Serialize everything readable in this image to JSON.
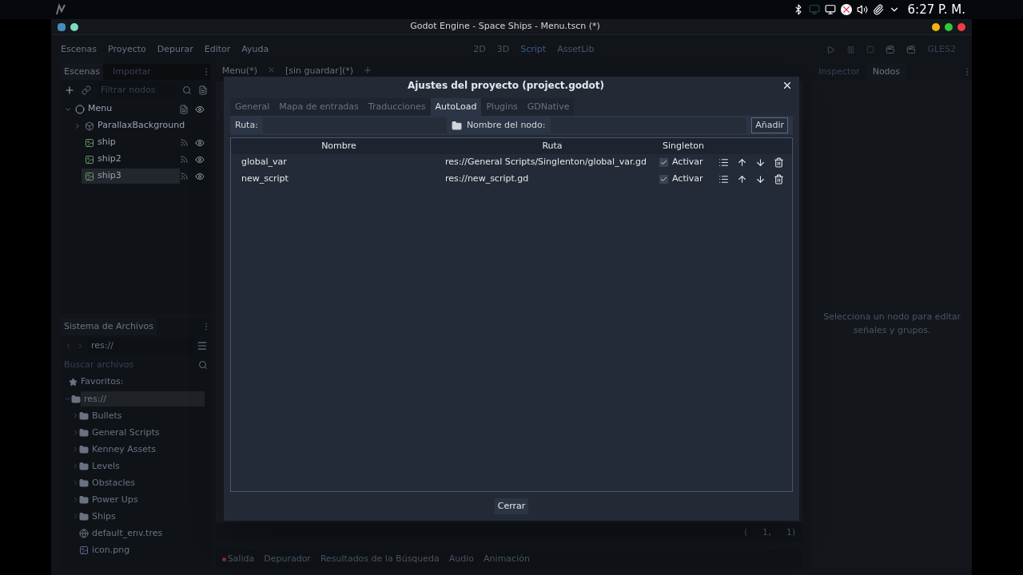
{
  "system_bar": {
    "time": "6:27 P. M."
  },
  "window": {
    "title": "Godot Engine - Space Ships - Menu.tscn (*)"
  },
  "menu": [
    "Escenas",
    "Proyecto",
    "Depurar",
    "Editor",
    "Ayuda"
  ],
  "workspaces": [
    {
      "label": "2D",
      "selected": false
    },
    {
      "label": "3D",
      "selected": false
    },
    {
      "label": "Script",
      "selected": true
    },
    {
      "label": "AssetLib",
      "selected": false
    }
  ],
  "renderer": "GLES2",
  "scene_dock": {
    "tabs": [
      {
        "label": "Escenas",
        "selected": true
      },
      {
        "label": "Importar",
        "selected": false
      }
    ],
    "filter_placeholder": "Filtrar nodos",
    "tree": [
      {
        "name": "Menu",
        "kind": "root",
        "selected": false,
        "children": [
          {
            "name": "ParallaxBackground",
            "kind": "parallax",
            "selected": false
          },
          {
            "name": "ship",
            "kind": "sprite",
            "selected": false
          },
          {
            "name": "ship2",
            "kind": "sprite",
            "selected": false
          },
          {
            "name": "ship3",
            "kind": "sprite",
            "selected": true
          }
        ]
      }
    ]
  },
  "filesystem": {
    "title": "Sistema de Archivos",
    "path": "res://",
    "search_placeholder": "Buscar archivos",
    "favorites": "Favoritos:",
    "tree": [
      {
        "name": "res://",
        "kind": "folder",
        "selected": true,
        "children": [
          {
            "name": "Bullets",
            "kind": "folder",
            "selected": false
          },
          {
            "name": "General Scripts",
            "kind": "folder",
            "selected": false
          },
          {
            "name": "Kenney Assets",
            "kind": "folder",
            "selected": false
          },
          {
            "name": "Levels",
            "kind": "folder",
            "selected": false
          },
          {
            "name": "Obstacles",
            "kind": "folder",
            "selected": false
          },
          {
            "name": "Power Ups",
            "kind": "folder",
            "selected": false
          },
          {
            "name": "Ships",
            "kind": "folder",
            "selected": false
          },
          {
            "name": "default_env.tres",
            "kind": "resource",
            "selected": false
          },
          {
            "name": "icon.png",
            "kind": "image",
            "selected": false
          }
        ]
      }
    ]
  },
  "editor_tabs": [
    "Menu(*)",
    "[sin guardar](*)"
  ],
  "cursor": "(   1,   1)",
  "bottom_tabs": [
    "Salida",
    "Depurador",
    "Resultados de la Búsqueda",
    "Audio",
    "Animación"
  ],
  "right_dock": {
    "tabs": [
      {
        "label": "Inspector",
        "selected": false
      },
      {
        "label": "Nodos",
        "selected": true
      }
    ],
    "message": "Selecciona un nodo para editar señales y grupos."
  },
  "dialog": {
    "title": "Ajustes del proyecto (project.godot)",
    "tabs": [
      {
        "label": "General",
        "selected": false
      },
      {
        "label": "Mapa de entradas",
        "selected": false
      },
      {
        "label": "Traducciones",
        "selected": false
      },
      {
        "label": "AutoLoad",
        "selected": true
      },
      {
        "label": "Plugins",
        "selected": false
      },
      {
        "label": "GDNative",
        "selected": false
      }
    ],
    "path_label": "Ruta:",
    "node_name_label": "Nombre del nodo:",
    "add_button": "Añadir",
    "columns": [
      "Nombre",
      "Ruta",
      "Singleton"
    ],
    "rows": [
      {
        "name": "global_var",
        "path": "res://General Scripts/Singlenton/global_var.gd",
        "checked": true,
        "check_label": "Activar"
      },
      {
        "name": "new_script",
        "path": "res://new_script.gd",
        "checked": true,
        "check_label": "Activar"
      }
    ],
    "close_button": "Cerrar"
  }
}
